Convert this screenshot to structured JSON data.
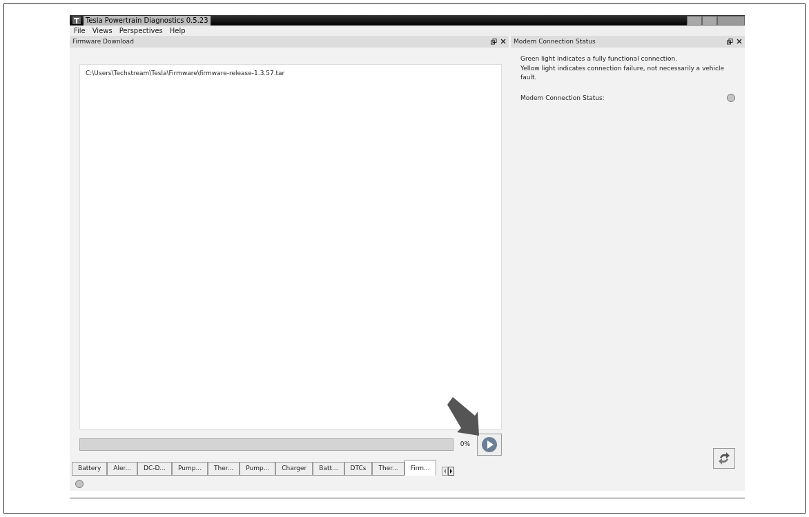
{
  "window": {
    "title": "Tesla Powertrain Diagnostics 0.5.23"
  },
  "menu": [
    "File",
    "Views",
    "Perspectives",
    "Help"
  ],
  "firmware_panel": {
    "title": "Firmware Download",
    "file_path": "C:\\Users\\Techstream\\Tesla\\Firmware\\firmware-release-1.3.57.tar",
    "progress": {
      "reading": "0%"
    }
  },
  "tabs": [
    {
      "label": "Battery",
      "selected": false
    },
    {
      "label": "Aler...",
      "selected": false
    },
    {
      "label": "DC-D...",
      "selected": false
    },
    {
      "label": "Pump...",
      "selected": false
    },
    {
      "label": "Ther...",
      "selected": false
    },
    {
      "label": "Pump...",
      "selected": false
    },
    {
      "label": "Charger",
      "selected": false
    },
    {
      "label": "Batt...",
      "selected": false
    },
    {
      "label": "DTCs",
      "selected": false
    },
    {
      "label": "Ther...",
      "selected": false
    },
    {
      "label": "Firm...",
      "selected": true
    }
  ],
  "status_light_on": false,
  "modem_panel": {
    "title": "Modem Connection Status",
    "notes": [
      "Green light indicates a fully functional connection.",
      "Yellow light indicates connection failure, not necessarily a vehicle fault."
    ],
    "status_label": "Modem Connection Status:",
    "light_on": false
  }
}
